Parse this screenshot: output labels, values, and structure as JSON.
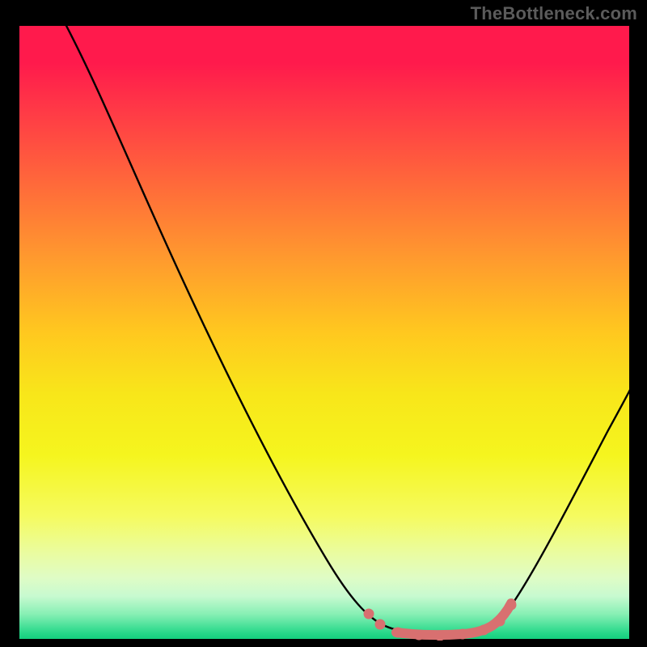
{
  "watermark": "TheBottleneck.com",
  "colors": {
    "background": "#000000",
    "gradient_top": "#ff1a4c",
    "gradient_mid": "#f8e61a",
    "gradient_bottom": "#14cf7e",
    "curve_main": "#000000",
    "highlight": "#d87070",
    "watermark_text": "#5b5b5b"
  },
  "chart_data": {
    "type": "line",
    "title": "",
    "xlabel": "",
    "ylabel": "",
    "xlim": [
      0,
      100
    ],
    "ylim": [
      0,
      100
    ],
    "grid": false,
    "legend": false,
    "series": [
      {
        "name": "bottleneck_curve",
        "x": [
          7,
          13,
          19,
          26,
          34,
          42,
          50,
          55,
          59,
          62,
          65,
          68,
          72,
          76,
          79,
          82,
          87,
          92,
          96,
          100
        ],
        "values": [
          100,
          89,
          76,
          59,
          42,
          26,
          13,
          6,
          3,
          1.5,
          1,
          0.8,
          1,
          1.6,
          3,
          6,
          14,
          26,
          34,
          41
        ]
      },
      {
        "name": "highlighted_points",
        "x": [
          57,
          59,
          62,
          65,
          69,
          72,
          76,
          78,
          80
        ],
        "values": [
          4.3,
          2.6,
          1.3,
          0.9,
          0.8,
          1.0,
          1.6,
          3.2,
          5.8
        ]
      }
    ],
    "annotations": [
      {
        "text": "TheBottleneck.com",
        "position": "top-right"
      }
    ]
  }
}
